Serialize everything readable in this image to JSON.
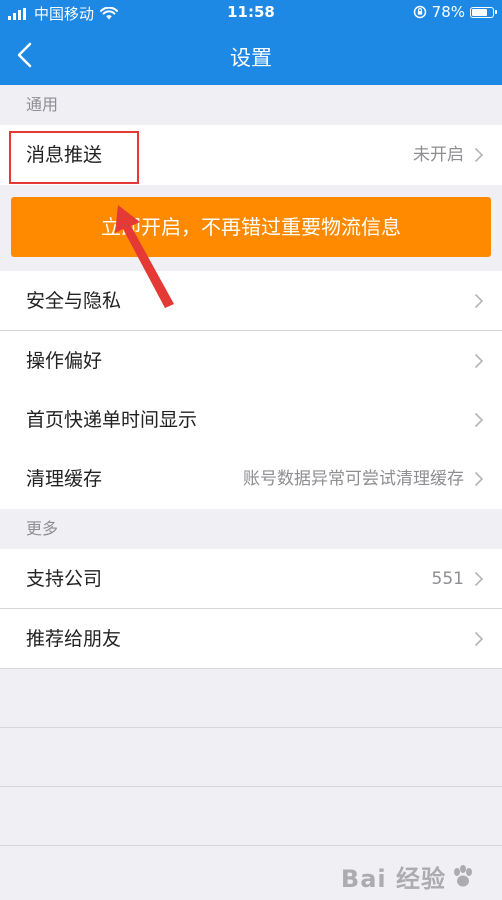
{
  "status_bar": {
    "carrier": "中国移动",
    "time": "11:58",
    "battery_percent": "78%",
    "battery_level": 0.78
  },
  "nav": {
    "title": "设置"
  },
  "sections": {
    "general_header": "通用",
    "more_header": "更多"
  },
  "rows": {
    "push": {
      "label": "消息推送",
      "value": "未开启"
    },
    "security": {
      "label": "安全与隐私"
    },
    "prefs": {
      "label": "操作偏好"
    },
    "home_time": {
      "label": "首页快递单时间显示"
    },
    "cache": {
      "label": "清理缓存",
      "value": "账号数据异常可尝试清理缓存"
    },
    "companies": {
      "label": "支持公司",
      "value": "551"
    },
    "recommend": {
      "label": "推荐给朋友"
    }
  },
  "banner": {
    "text": "立即开启，不再错过重要物流信息"
  },
  "watermark": {
    "text": "Bai 经验"
  },
  "colors": {
    "primary": "#1e88e5",
    "banner": "#ff8a00",
    "highlight": "#e53935"
  }
}
